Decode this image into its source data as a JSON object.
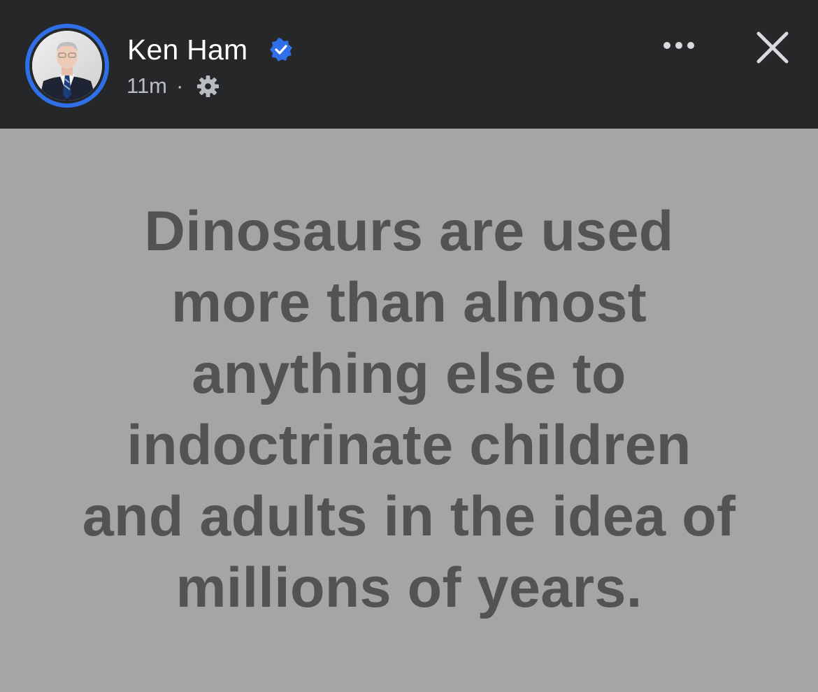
{
  "header": {
    "name": "Ken Ham",
    "verified_icon": "verified-badge-icon",
    "timestamp": "11m",
    "separator": "·",
    "audience_icon": "gear-icon",
    "more_icon": "more-options-icon",
    "close_icon": "close-icon",
    "accent_color": "#2f6fe8",
    "background_color": "#262729"
  },
  "post": {
    "background_color": "#a5a5a5",
    "text_color": "#535353",
    "lines": [
      "Dinosaurs are used",
      "more than almost",
      "anything else to",
      "indoctrinate children",
      "and adults in the idea of",
      "millions of years."
    ]
  }
}
